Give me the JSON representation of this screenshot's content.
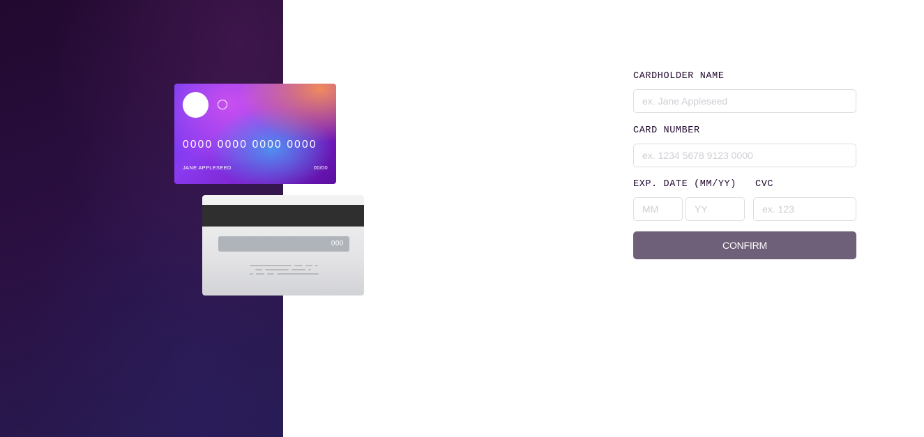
{
  "card_front": {
    "number": "0000 0000 0000 0000",
    "name": "JANE APPLESEED",
    "expiry": "00/00"
  },
  "card_back": {
    "cvc": "000"
  },
  "form": {
    "cardholder_label": "CARDHOLDER NAME",
    "cardholder_placeholder": "ex. Jane Appleseed",
    "number_label": "CARD NUMBER",
    "number_placeholder": "ex. 1234 5678 9123 0000",
    "expiry_label": "EXP. DATE (MM/YY)",
    "month_placeholder": "MM",
    "year_placeholder": "YY",
    "cvc_label": "CVC",
    "cvc_placeholder": "ex. 123",
    "confirm_label": "CONFIRM"
  },
  "colors": {
    "panel_dark": "#21092f",
    "button": "#6e6078",
    "input_border": "#dedddf",
    "placeholder": "#d0ced4"
  }
}
